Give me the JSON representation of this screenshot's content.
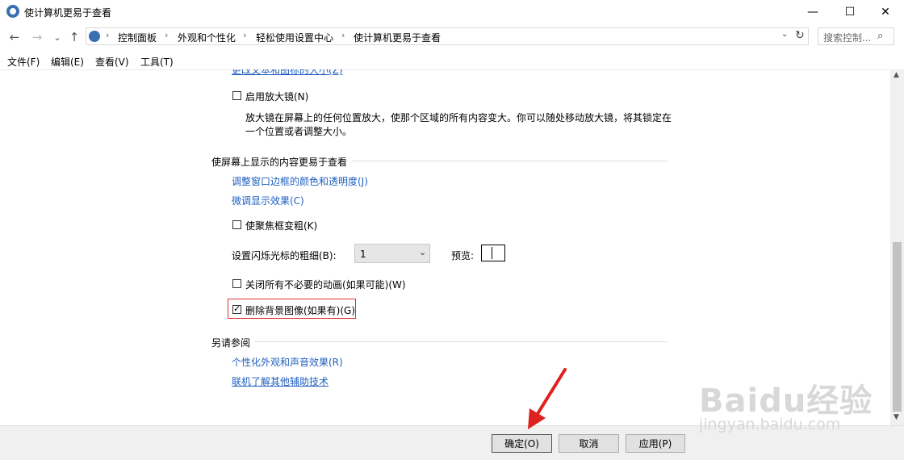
{
  "window": {
    "title": "使计算机更易于查看",
    "controls": {
      "minimize": "—",
      "maximize": "☐",
      "close": "✕"
    }
  },
  "nav": {
    "back": "←",
    "forward": "→",
    "recent": "⌄",
    "up": "↑"
  },
  "address": {
    "breadcrumbs": [
      "控制面板",
      "外观和个性化",
      "轻松使用设置中心",
      "使计算机更易于查看"
    ],
    "separator": "›",
    "dropdown": "⌄",
    "refresh": "↻"
  },
  "search": {
    "placeholder": "搜索控制...",
    "icon": "⌕"
  },
  "menu": {
    "items": [
      "文件(F)",
      "编辑(E)",
      "查看(V)",
      "工具(T)"
    ]
  },
  "content": {
    "partial_link": "更改文本和图标的大小(Z)",
    "magnifier": {
      "checkbox_label": "启用放大镜(N)",
      "checked": false,
      "description_line1": "放大镜在屏幕上的任何位置放大，使那个区域的所有内容变大。你可以随处移动放大镜，将其锁定在",
      "description_line2": "一个位置或者调整大小。"
    },
    "section_visibility": {
      "title": "使屏幕上显示的内容更易于查看",
      "link1": "调整窗口边框的颜色和透明度(J)",
      "link2": "微调显示效果(C)",
      "focus_checkbox": "使聚焦框变粗(K)",
      "cursor_label": "设置闪烁光标的粗细(B):",
      "cursor_value": "1",
      "preview_label": "预览:",
      "animations_checkbox": "关闭所有不必要的动画(如果可能)(W)",
      "background_checkbox": "删除背景图像(如果有)(G)",
      "background_checked": true
    },
    "see_also": {
      "title": "另请参阅",
      "link1": "个性化外观和声音效果(R)",
      "link2": "联机了解其他辅助技术"
    }
  },
  "footer": {
    "ok": "确定(O)",
    "cancel": "取消",
    "apply": "应用(P)"
  },
  "watermark": {
    "logo": "Baidu经验",
    "sub": "jingyan.baidu.com"
  },
  "colors": {
    "link": "#1f5fbf",
    "highlight_border": "#e03030",
    "arrow": "#e02020"
  }
}
